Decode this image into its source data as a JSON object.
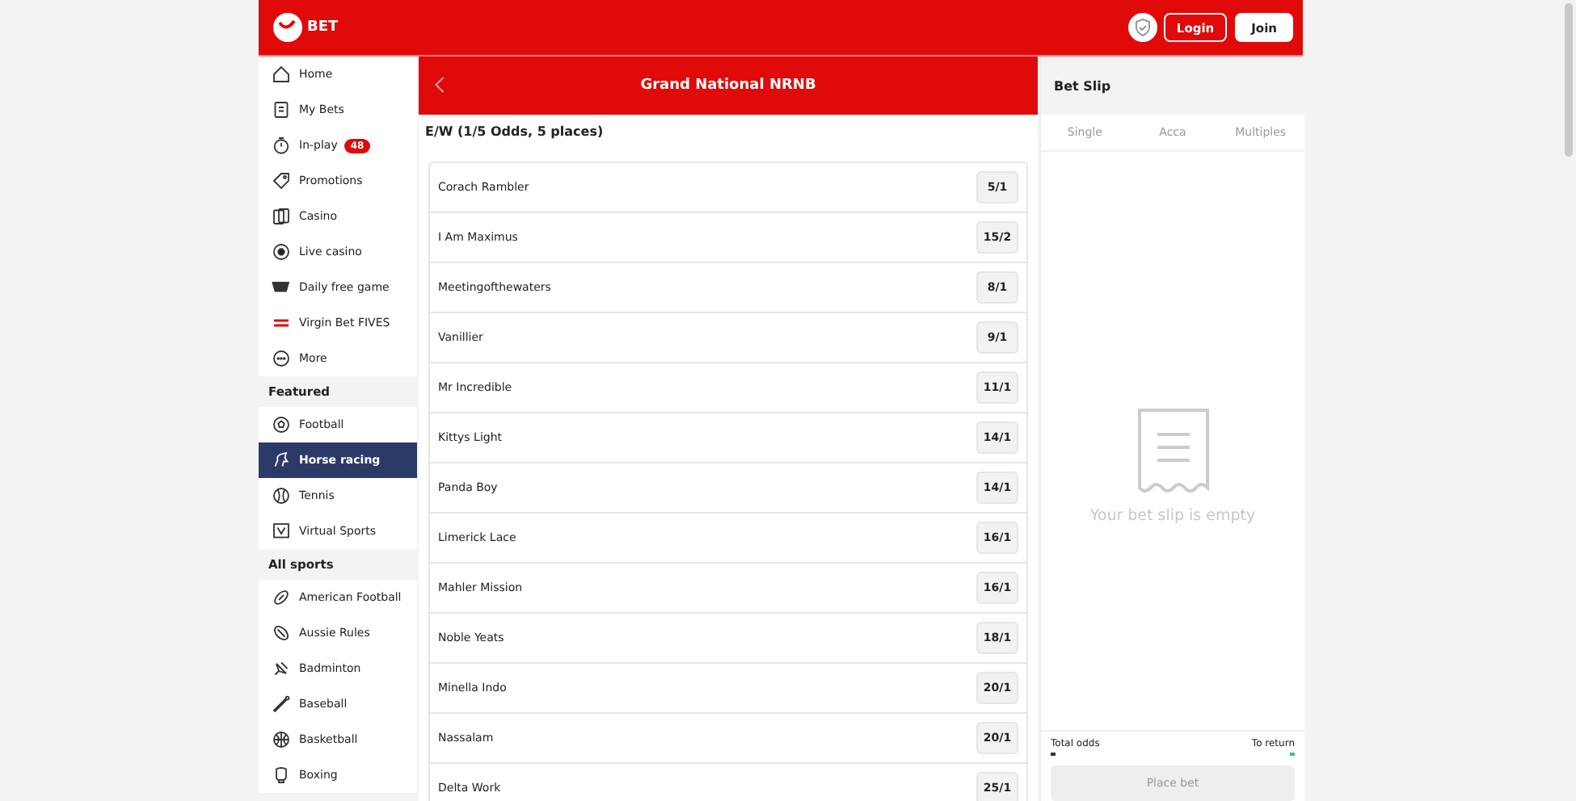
{
  "header": {
    "logo": "BET",
    "buttons": [
      {
        "label": "Login",
        "kind": "outline"
      },
      {
        "label": "Join",
        "kind": "solid"
      }
    ]
  },
  "sidebar": {
    "sections": [
      {
        "items": [
          {
            "label": "Home",
            "selected": false
          },
          {
            "label": "My Bets",
            "selected": false
          },
          {
            "label": "In-play",
            "selected": false,
            "badge": "48"
          },
          {
            "label": "Promotions",
            "selected": false
          },
          {
            "label": "Casino",
            "selected": false
          },
          {
            "label": "Live casino",
            "selected": false
          },
          {
            "label": "Daily free game",
            "selected": false
          },
          {
            "label": "Virgin Bet FIVES",
            "selected": false
          },
          {
            "label": "More",
            "selected": false
          }
        ]
      },
      {
        "title": "Featured",
        "items": [
          {
            "label": "Football",
            "selected": false
          },
          {
            "label": "Horse racing",
            "selected": true
          },
          {
            "label": "Tennis",
            "selected": false
          },
          {
            "label": "Virtual Sports",
            "selected": false
          }
        ]
      },
      {
        "title": "All sports",
        "items": [
          {
            "label": "American Football",
            "selected": false
          },
          {
            "label": "Aussie Rules",
            "selected": false
          },
          {
            "label": "Badminton",
            "selected": false
          },
          {
            "label": "Baseball",
            "selected": false
          },
          {
            "label": "Basketball",
            "selected": false
          },
          {
            "label": "Boxing",
            "selected": false
          }
        ]
      }
    ]
  },
  "market": {
    "title": "Grand National NRNB",
    "subtitle": "E/W (1/5 Odds, 5 places)",
    "runners": [
      {
        "name": "Corach Rambler",
        "odds": "5/1"
      },
      {
        "name": "I Am Maximus",
        "odds": "15/2"
      },
      {
        "name": "Meetingofthewaters",
        "odds": "8/1"
      },
      {
        "name": "Vanillier",
        "odds": "9/1"
      },
      {
        "name": "Mr Incredible",
        "odds": "11/1"
      },
      {
        "name": "Kittys Light",
        "odds": "14/1"
      },
      {
        "name": "Panda Boy",
        "odds": "14/1"
      },
      {
        "name": "Limerick Lace",
        "odds": "16/1"
      },
      {
        "name": "Mahler Mission",
        "odds": "16/1"
      },
      {
        "name": "Noble Yeats",
        "odds": "18/1"
      },
      {
        "name": "Minella Indo",
        "odds": "20/1"
      },
      {
        "name": "Nassalam",
        "odds": "20/1"
      },
      {
        "name": "Delta Work",
        "odds": "25/1"
      }
    ]
  },
  "bet_slip": {
    "title": "Bet Slip",
    "tabs": [
      {
        "label": "Single",
        "selected": false
      },
      {
        "label": "Acca",
        "selected": false
      },
      {
        "label": "Multiples",
        "selected": false
      }
    ],
    "empty_message": "Your bet slip is empty",
    "total_odds_label": "Total odds",
    "to_return_label": "To return",
    "place_bet": {
      "label": "Place bet",
      "disabled": true
    }
  }
}
